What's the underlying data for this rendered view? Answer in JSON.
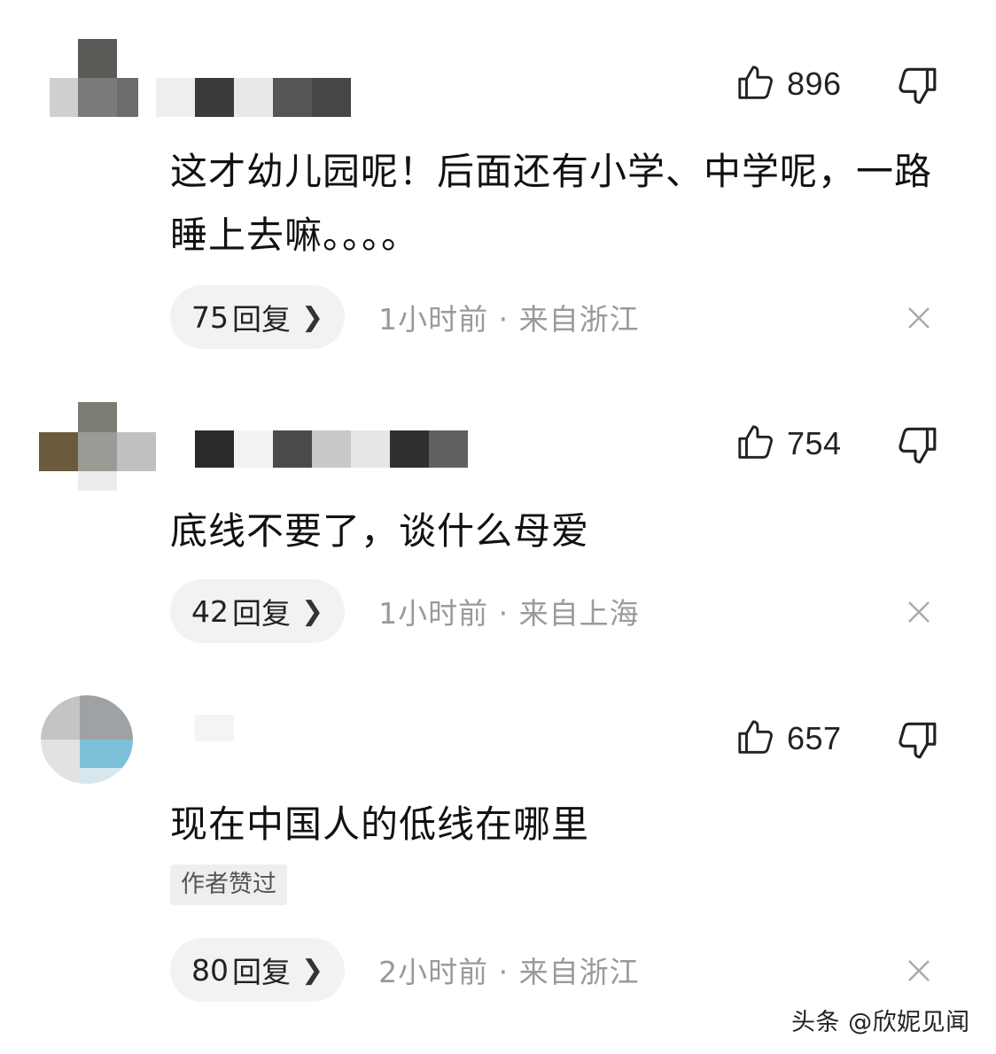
{
  "comments": [
    {
      "likes": "896",
      "text": "这才幼儿园呢！后面还有小学、中学呢，一路睡上去嘛。。。。",
      "replies_count": "75",
      "replies_label": "回复",
      "time": "1小时前",
      "location": "来自浙江"
    },
    {
      "likes": "754",
      "text": "底线不要了，谈什么母爱",
      "replies_count": "42",
      "replies_label": "回复",
      "time": "1小时前",
      "location": "来自上海"
    },
    {
      "likes": "657",
      "text": "现在中国人的低线在哪里",
      "badge": "作者赞过",
      "replies_count": "80",
      "replies_label": "回复",
      "time": "2小时前",
      "location": "来自浙江"
    }
  ],
  "separator": "·",
  "icons": {
    "like": "thumbs-up-icon",
    "dislike": "thumbs-down-icon",
    "close": "close-icon",
    "chevron": "chevron-right-icon"
  },
  "watermark": "头条 @欣妮见闻"
}
